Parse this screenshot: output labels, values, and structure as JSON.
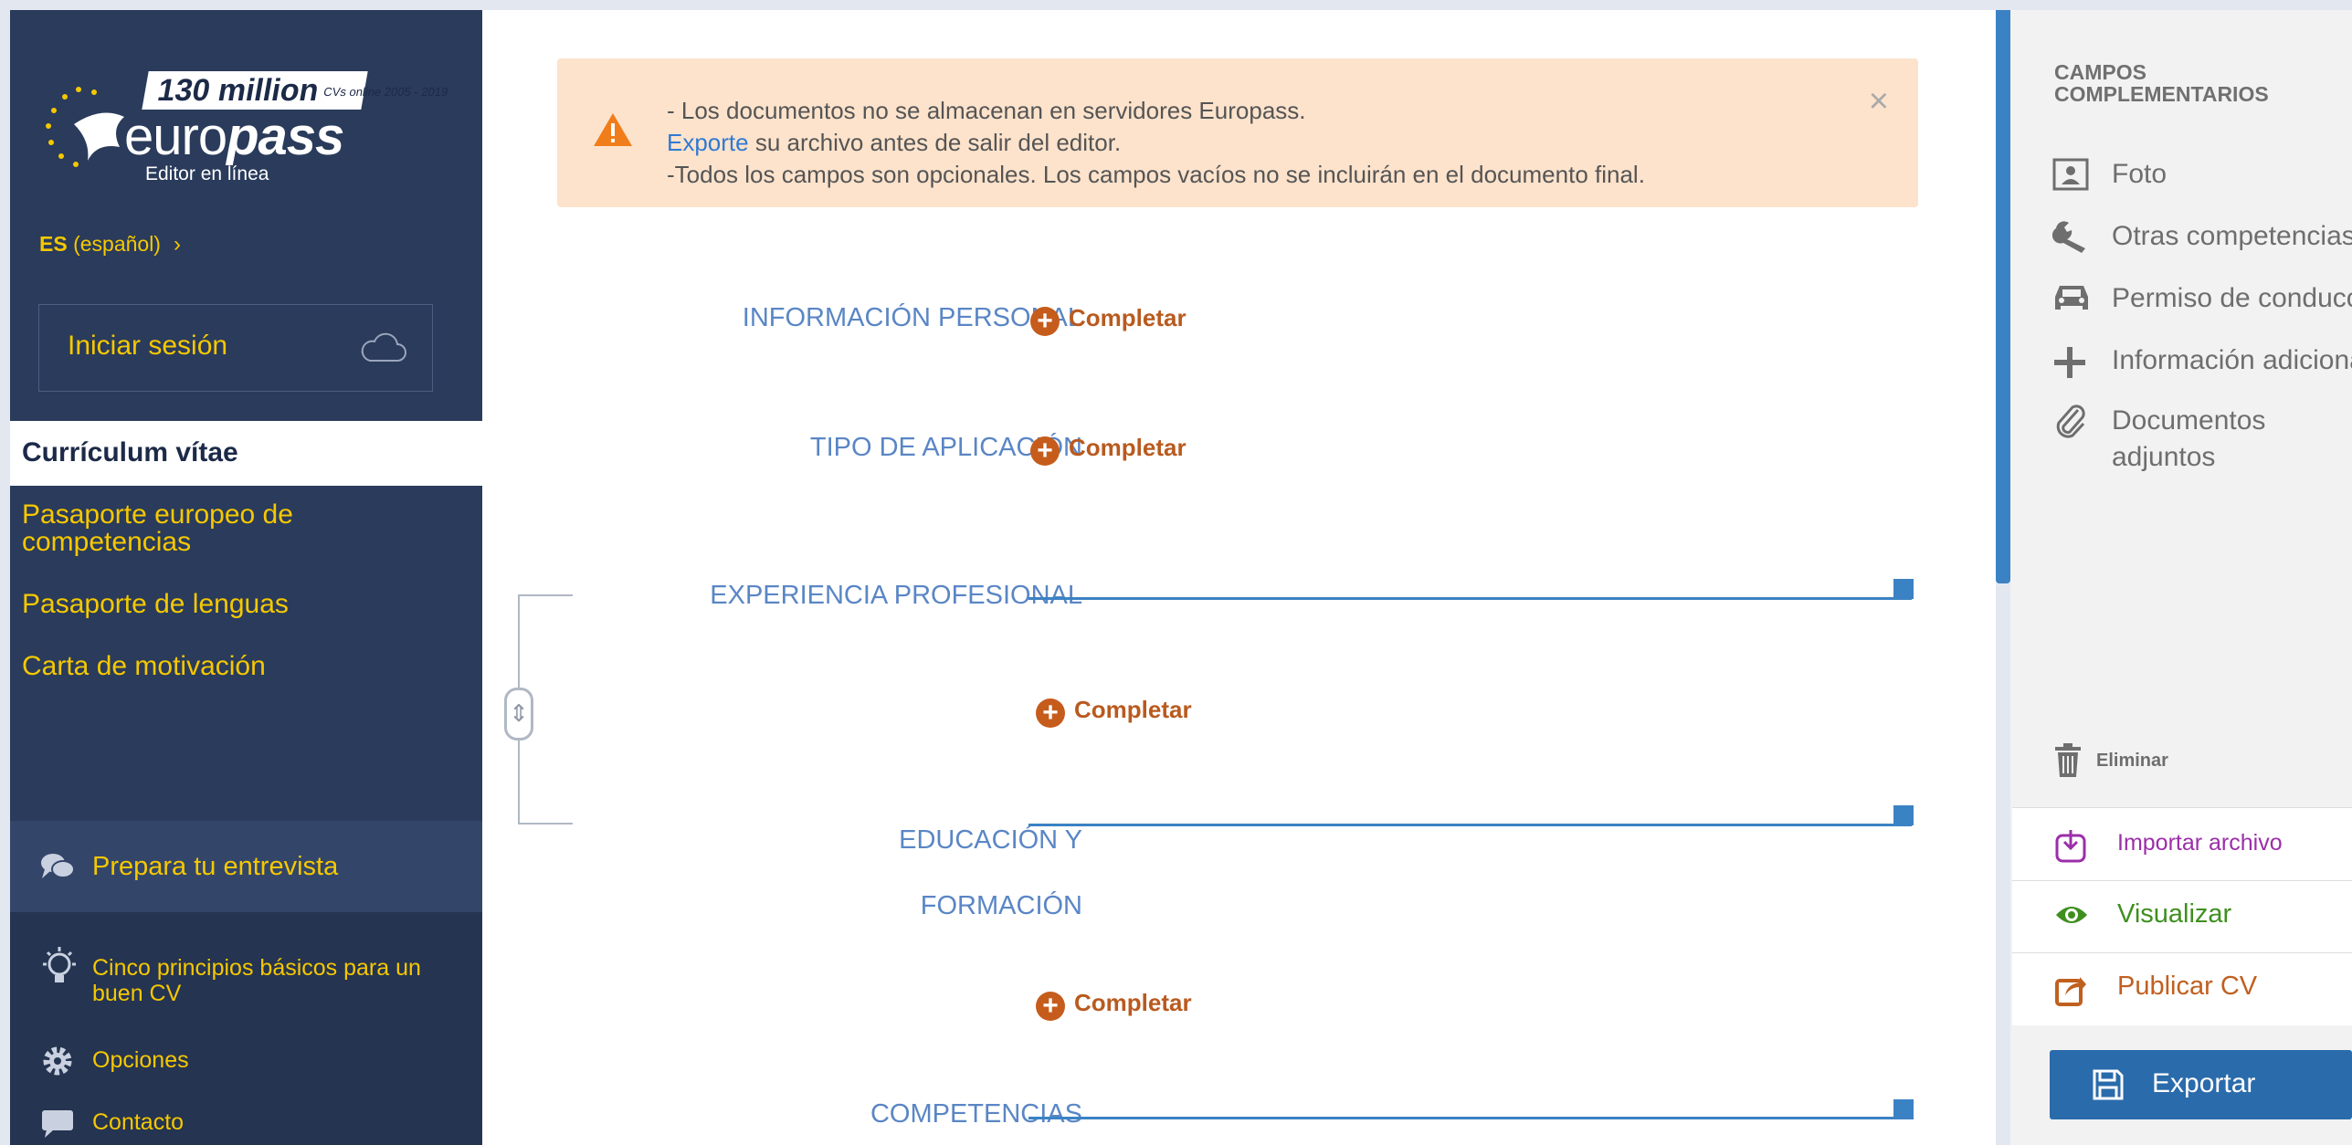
{
  "sidebar": {
    "logo": {
      "badge": "130 million",
      "badge_sub": "CVs online 2005 - 2019",
      "word_regular": "euro",
      "word_bold": "pass",
      "sub": "Editor en línea"
    },
    "language": {
      "code": "ES",
      "name": "(español)"
    },
    "login_label": "Iniciar sesión",
    "active_item": "Currículum vítae",
    "items": [
      {
        "label": "Pasaporte europeo de competencias"
      },
      {
        "label": "Pasaporte de lenguas"
      },
      {
        "label": "Carta de motivación"
      }
    ],
    "interview_label": "Prepara tu entrevista",
    "bottom": [
      {
        "label": "Cinco principios básicos para un buen CV",
        "icon": "lightbulb-icon"
      },
      {
        "label": "Opciones",
        "icon": "gear-icon"
      },
      {
        "label": "Contacto",
        "icon": "speech-bubble-icon"
      }
    ]
  },
  "alert": {
    "line1": "- Los documentos no se almacenan en servidores Europass.",
    "line2_link": "Exporte",
    "line2_rest": " su archivo antes de salir del editor.",
    "line3": "-Todos los campos son opcionales. Los campos vacíos no se incluirán en el documento final.",
    "close": "×"
  },
  "sections": [
    {
      "label": "INFORMACIÓN PERSONAL",
      "action": "Completar"
    },
    {
      "label": "TIPO DE APLICACIÓN",
      "action": "Completar"
    },
    {
      "label": "EXPERIENCIA PROFESIONAL",
      "action": "Completar"
    },
    {
      "label_line1": "EDUCACIÓN Y",
      "label_line2": "FORMACIÓN",
      "action": "Completar"
    },
    {
      "label": "COMPETENCIAS"
    }
  ],
  "right_panel": {
    "heading_line1": "CAMPOS",
    "heading_line2": "COMPLEMENTARIOS",
    "items": [
      {
        "label": "Foto",
        "icon": "photo-icon"
      },
      {
        "label": "Otras competencias",
        "icon": "wrench-icon"
      },
      {
        "label": "Permiso de conducción",
        "icon": "car-icon"
      },
      {
        "label": "Información adicional",
        "icon": "plus-icon"
      },
      {
        "label_line1": "Documentos",
        "label_line2": "adjuntos",
        "icon": "paperclip-icon"
      }
    ],
    "delete_label": "Eliminar",
    "actions": [
      {
        "label": "Importar archivo",
        "color": "#9b2fa8"
      },
      {
        "label": "Visualizar",
        "color": "#3f8f1f"
      },
      {
        "label": "Publicar CV",
        "color": "#c0601f"
      }
    ],
    "export_label": "Exportar"
  },
  "colors": {
    "sidebar_bg": "#2a3b5b",
    "accent_yellow": "#f5c800",
    "section_blue": "#5a86c5",
    "complete_orange": "#c65c1c",
    "alert_bg": "#fde3cc",
    "export_blue": "#2a6bab"
  }
}
